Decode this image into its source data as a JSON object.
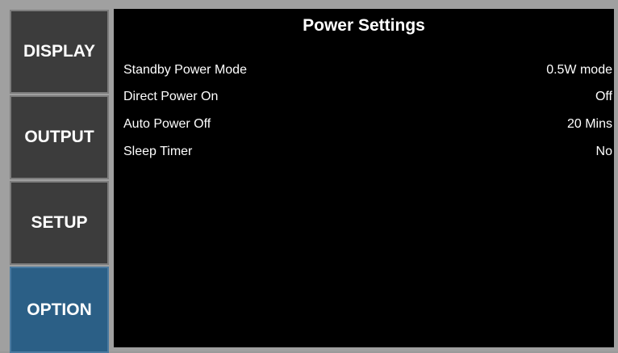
{
  "sidebar": {
    "items": [
      {
        "label": "DISPLAY"
      },
      {
        "label": "OUTPUT"
      },
      {
        "label": "SETUP"
      },
      {
        "label": "OPTION"
      }
    ],
    "active": "OPTION",
    "colors": {
      "normal": "#3c3c3c",
      "active": "#2b5f86"
    }
  },
  "panel": {
    "title": "Power Settings",
    "rows": [
      {
        "label": "Standby Power Mode",
        "value": "0.5W mode"
      },
      {
        "label": "Direct Power On",
        "value": "Off"
      },
      {
        "label": "Auto Power Off",
        "value": "20 Mins"
      },
      {
        "label": "Sleep Timer",
        "value": "No"
      }
    ]
  }
}
